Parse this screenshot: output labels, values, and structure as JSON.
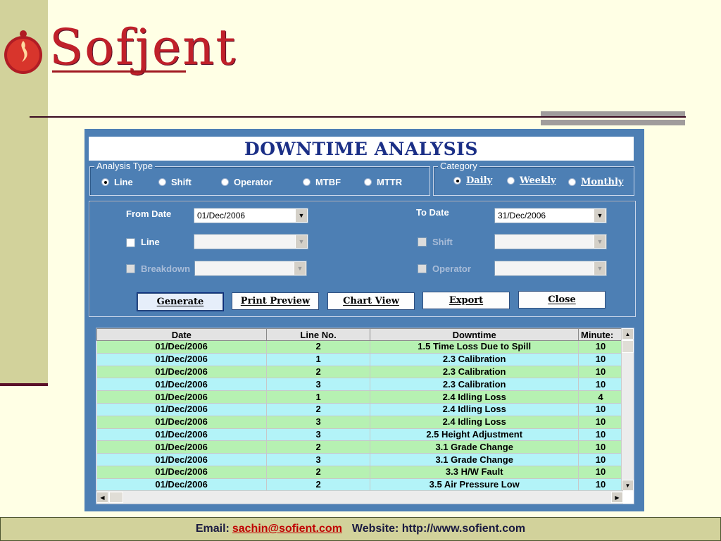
{
  "brand": {
    "name": "Sofjent"
  },
  "window": {
    "title": "DOWNTIME ANALYSIS"
  },
  "analysis_type": {
    "legend": "Analysis Type",
    "options": [
      "Line",
      "Shift",
      "Operator",
      "MTBF",
      "MTTR"
    ],
    "selected": "Line"
  },
  "category": {
    "legend": "Category",
    "options": [
      "Daily",
      "Weekly",
      "Monthly"
    ],
    "selected": "Daily"
  },
  "filters": {
    "from_date_label": "From Date",
    "from_date_value": "01/Dec/2006",
    "to_date_label": "To Date",
    "to_date_value": "31/Dec/2006",
    "line_label": "Line",
    "breakdown_label": "Breakdown",
    "shift_label": "Shift",
    "operator_label": "Operator"
  },
  "buttons": {
    "generate": "Generate",
    "print_preview": "Print Preview",
    "chart_view": "Chart View",
    "export": "Export",
    "close": "Close"
  },
  "table": {
    "columns": [
      "Date",
      "Line No.",
      "Downtime",
      "Minute:"
    ],
    "rows": [
      [
        "01/Dec/2006",
        "2",
        "1.5 Time Loss Due to Spill",
        "10"
      ],
      [
        "01/Dec/2006",
        "1",
        "2.3 Calibration",
        "10"
      ],
      [
        "01/Dec/2006",
        "2",
        "2.3 Calibration",
        "10"
      ],
      [
        "01/Dec/2006",
        "3",
        "2.3 Calibration",
        "10"
      ],
      [
        "01/Dec/2006",
        "1",
        "2.4 Idling Loss",
        "4"
      ],
      [
        "01/Dec/2006",
        "2",
        "2.4 Idling Loss",
        "10"
      ],
      [
        "01/Dec/2006",
        "3",
        "2.4 Idling Loss",
        "10"
      ],
      [
        "01/Dec/2006",
        "3",
        "2.5 Height Adjustment",
        "10"
      ],
      [
        "01/Dec/2006",
        "2",
        "3.1 Grade Change",
        "10"
      ],
      [
        "01/Dec/2006",
        "3",
        "3.1 Grade Change",
        "10"
      ],
      [
        "01/Dec/2006",
        "2",
        "3.3 H/W Fault",
        "10"
      ],
      [
        "01/Dec/2006",
        "2",
        "3.5 Air Pressure Low",
        "10"
      ]
    ]
  },
  "footer": {
    "email_label": "Email:",
    "email": "sachin@sofient.com",
    "website_label": "Website: http://www.sofient.com"
  },
  "colors": {
    "accent": "#4d7fb4",
    "title": "#1b2f86",
    "row_green": "#b6f1b2",
    "row_cyan": "#b3f3f8",
    "brand": "#c0202a"
  }
}
